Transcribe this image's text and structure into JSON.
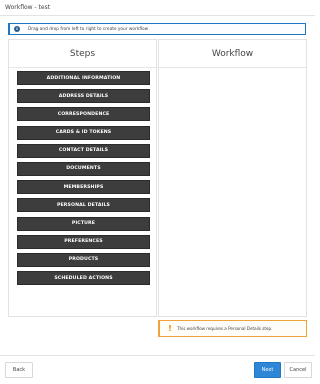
{
  "window": {
    "title": "Workflow - test"
  },
  "info_banner": {
    "icon": "info-circle-icon",
    "text": "Drag and drop from left to right to create your workflow"
  },
  "steps_panel": {
    "heading": "Steps",
    "items": [
      "ADDITIONAL INFORMATION",
      "ADDRESS DETAILS",
      "CORRESPONDENCE",
      "CARDS & ID TOKENS",
      "CONTACT DETAILS",
      "DOCUMENTS",
      "MEMBERSHIPS",
      "PERSONAL DETAILS",
      "PICTURE",
      "PREFERENCES",
      "PRODUCTS",
      "SCHEDULED ACTIONS"
    ]
  },
  "workflow_panel": {
    "heading": "Workflow"
  },
  "warning_banner": {
    "icon": "exclamation-icon",
    "text": "This workflow requires a Personal Details step."
  },
  "footer": {
    "back_label": "Back",
    "next_label": "Next",
    "cancel_label": "Cancel"
  },
  "colors": {
    "step_bg": "#3d3d3d",
    "info_border": "#1f77c4",
    "warning_border": "#f0a33a",
    "primary_button": "#2d86d6"
  }
}
